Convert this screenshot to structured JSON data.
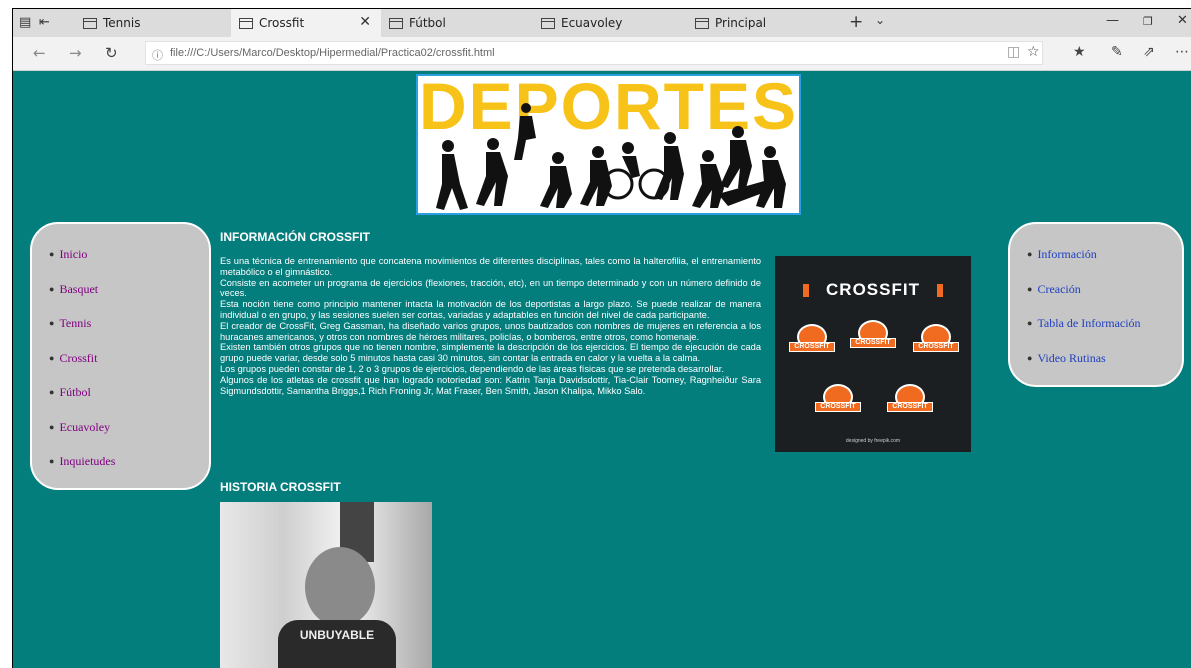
{
  "browser": {
    "tabs": [
      {
        "label": "Tennis",
        "active": false
      },
      {
        "label": "Crossfit",
        "active": true
      },
      {
        "label": "Fútbol",
        "active": false
      },
      {
        "label": "Ecuavoley",
        "active": false
      },
      {
        "label": "Principal",
        "active": false
      }
    ],
    "url": "file:///C:/Users/Marco/Desktop/Hipermedial/Practica02/crossfit.html",
    "icons": {
      "back": "back-arrow-icon",
      "forward": "forward-arrow-icon",
      "refresh": "refresh-icon",
      "reading_view": "reading-view-icon",
      "favorite": "star-icon",
      "favorites_hub": "favorites-list-icon",
      "notes": "pen-icon",
      "share": "share-icon",
      "more": "more-icon"
    }
  },
  "page": {
    "background": "#047d7d",
    "banner": {
      "title": "DEPORTES",
      "title_color": "#f7c318"
    },
    "left_nav": [
      "Inicio",
      "Basquet",
      "Tennis",
      "Crossfit",
      "Fútbol",
      "Ecuavoley",
      "Inquietudes"
    ],
    "right_nav": [
      "Información",
      "Creación",
      "Tabla de Información",
      "Video Rutinas"
    ],
    "info_heading": "INFORMACIÓN CROSSFIT",
    "info_paragraphs": [
      "Es una técnica de entrenamiento que concatena movimientos de diferentes disciplinas, tales como la halterofilia, el entrenamiento metabólico o el gimnástico.",
      "Consiste en acometer un programa de ejercicios (flexiones, tracción, etc), en un tiempo determinado y con un número definido de veces.",
      "Esta noción tiene como principio mantener intacta la motivación de los deportistas a largo plazo. Se puede realizar de manera individual o en grupo, y las sesiones suelen ser cortas, variadas y adaptables en función del nivel de cada participante.",
      "El creador de CrossFit, Greg Gassman, ha diseñado varios grupos, unos bautizados con nombres de mujeres en referencia a los huracanes americanos, y otros con nombres de héroes militares, policías, o bomberos, entre otros, como homenaje.",
      "Existen también otros grupos que no tienen nombre, simplemente la descripción de los ejercicios. El tiempo de ejecución de cada grupo puede variar, desde solo 5 minutos hasta casi 30 minutos, sin contar la entrada en calor y la vuelta a la calma.",
      "Los grupos pueden constar de 1, 2 o 3 grupos de ejercicios, dependiendo de las áreas físicas que se pretenda desarrollar.",
      "Algunos de los atletas de crossfit que han logrado notoriedad son: Katrin Tanja Davidsdottir, Tia-Clair Toomey, Ragnheiður Sara Sigmundsdottir, Samantha Briggs,1 Rich Froning Jr, Mat Fraser, Ben Smith, Jason Khalipa, Mikko Salo."
    ],
    "crossfit_image": {
      "title": "CROSSFIT",
      "badge_label": "CROSSFIT",
      "credit": "designed by freepik.com"
    },
    "history_heading": "HISTORIA CROSSFIT",
    "history_image": {
      "shirt_text": "UNBUYABLE"
    }
  }
}
